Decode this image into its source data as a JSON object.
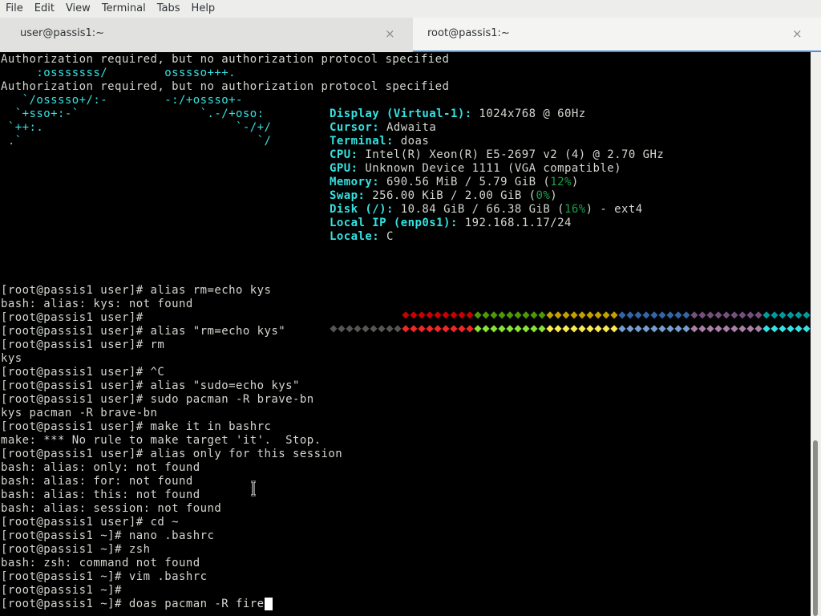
{
  "menubar": [
    "File",
    "Edit",
    "View",
    "Terminal",
    "Tabs",
    "Help"
  ],
  "tabs": [
    {
      "label": "user@passis1:~",
      "close": "×"
    },
    {
      "label": "root@passis1:~",
      "close": "×"
    }
  ],
  "terminal": {
    "header_lines": [
      "Authorization required, but no authorization protocol specified",
      "     :osssssss/        osssso+++.",
      "Authorization required, but no authorization protocol specified",
      "   `/osssso+/:-        -:/+ossso+-",
      "  `+sso+:-`                 `.-/+oso:",
      " `++:.                           `-/+/",
      " .`                                 `/"
    ],
    "sysinfo": [
      {
        "key": "Display (Virtual-1)",
        "value": "1024x768 @ 60Hz"
      },
      {
        "key": "Cursor",
        "value": "Adwaita"
      },
      {
        "key": "Terminal",
        "value": "doas"
      },
      {
        "key": "CPU",
        "value": "Intel(R) Xeon(R) E5-2697 v2 (4) @ 2.70 GHz"
      },
      {
        "key": "GPU",
        "value": "Unknown Device 1111 (VGA compatible)"
      },
      {
        "key": "Memory",
        "value": "690.56 MiB / 5.79 GiB (",
        "pct": "12%",
        "tail": ")"
      },
      {
        "key": "Swap",
        "value": "256.00 KiB / 2.00 GiB (",
        "pct": "0%",
        "tail": ")"
      },
      {
        "key": "Disk (/)",
        "value": "10.84 GiB / 66.38 GiB (",
        "pct": "16%",
        "tail": ") - ext4"
      },
      {
        "key": "Local IP (enp0s1)",
        "value": "192.168.1.17/24"
      },
      {
        "key": "Locale",
        "value": "C"
      }
    ],
    "palette_row1": [
      "#000000",
      "#cc0000",
      "#4e9a06",
      "#c4a000",
      "#3465a4",
      "#75507b",
      "#06989a",
      "#d3d7cf"
    ],
    "palette_row2": [
      "#555753",
      "#ef2929",
      "#8ae234",
      "#fce94f",
      "#729fcf",
      "#ad7fa8",
      "#34e2e2",
      "#eeeeec"
    ],
    "block_glyph": "◆",
    "session_lines": [
      "[root@passis1 user]# alias rm=echo kys",
      "bash: alias: kys: not found",
      "[root@passis1 user]#",
      "[root@passis1 user]# alias \"rm=echo kys\"",
      "[root@passis1 user]# rm",
      "kys",
      "[root@passis1 user]# ^C",
      "[root@passis1 user]# alias \"sudo=echo kys\"",
      "[root@passis1 user]# sudo pacman -R brave-bn",
      "kys pacman -R brave-bn",
      "[root@passis1 user]# make it in bashrc",
      "make: *** No rule to make target 'it'.  Stop.",
      "[root@passis1 user]# alias only for this session",
      "bash: alias: only: not found",
      "bash: alias: for: not found",
      "bash: alias: this: not found",
      "bash: alias: session: not found",
      "[root@passis1 user]# cd ~",
      "[root@passis1 ~]# nano .bashrc",
      "[root@passis1 ~]# zsh",
      "bash: zsh: command not found",
      "[root@passis1 ~]# vim .bashrc",
      "[root@passis1 ~]#",
      "[root@passis1 ~]# doas pacman -R fire"
    ]
  }
}
